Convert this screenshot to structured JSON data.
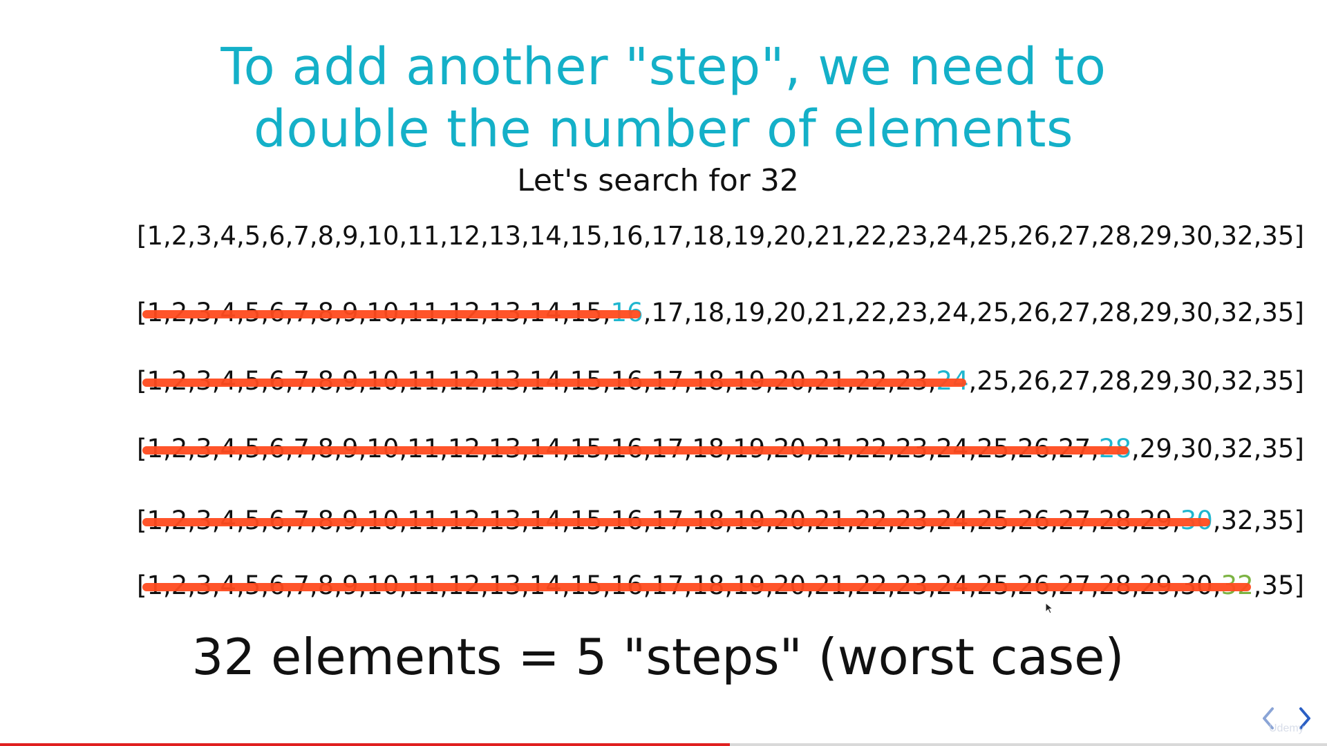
{
  "slide": {
    "title_line1": "To add another \"step\", we need to",
    "title_line2": "double the number of elements",
    "subtitle": "Let's search for 32",
    "rows": [
      {
        "before": "[1,2,3,4,5,6,7,8,9,10,11,12,13,14,15,16,17,18,19,20,21,22,23,24,25,26,27,28,29,30,32,35]",
        "highlight": "",
        "after": ""
      },
      {
        "before": "[1,2,3,4,5,6,7,8,9,10,11,12,13,14,15,",
        "highlight": "16",
        "after": ",17,18,19,20,21,22,23,24,25,26,27,28,29,30,32,35]"
      },
      {
        "before": "[1,2,3,4,5,6,7,8,9,10,11,12,13,14,15,16,17,18,19,20,21,22,23,",
        "highlight": "24",
        "after": ",25,26,27,28,29,30,32,35]"
      },
      {
        "before": "[1,2,3,4,5,6,7,8,9,10,11,12,13,14,15,16,17,18,19,20,21,22,23,24,25,26,27,",
        "highlight": "28",
        "after": ",29,30,32,35]"
      },
      {
        "before": "[1,2,3,4,5,6,7,8,9,10,11,12,13,14,15,16,17,18,19,20,21,22,23,24,25,26,27,28,29,",
        "highlight": "30",
        "after": ",32,35]"
      },
      {
        "before": "[1,2,3,4,5,6,7,8,9,10,11,12,13,14,15,16,17,18,19,20,21,22,23,24,25,26,27,28,29,30,",
        "highlight": "32",
        "after": ",35]"
      }
    ],
    "summary": "32 elements = 5 \"steps\" (worst case)"
  },
  "player": {
    "progress_fraction": 0.55,
    "progress_color": "#e02020",
    "watermark": "Udemy",
    "prev_icon": "chevron-left-icon",
    "next_icon": "chevron-right-icon"
  },
  "colors": {
    "title": "#14b0c8",
    "highlight_blue": "#1fb6cf",
    "highlight_green": "#7cb342",
    "strike": "#ff4b1f"
  }
}
